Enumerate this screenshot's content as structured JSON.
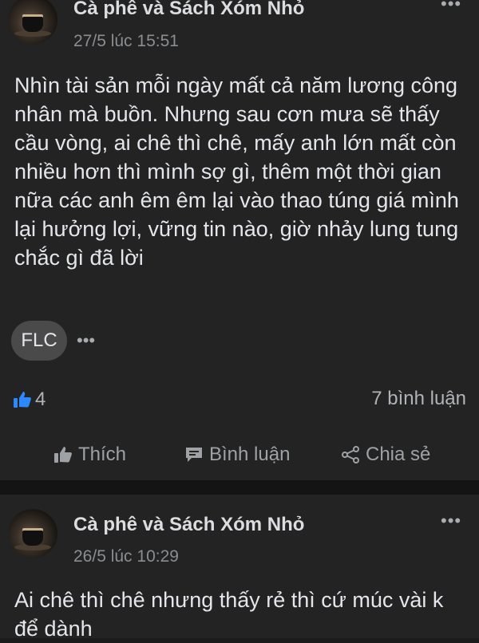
{
  "posts": [
    {
      "author": "Cà phê và Sách Xóm Nhỏ",
      "time": "27/5 lúc 15:51",
      "more": "•••",
      "body": "Nhìn tài sản mỗi ngày mất cả năm lương công nhân mà buồn. Nhưng sau cơn mưa sẽ thấy cầu vòng, ai chê thì chê, mấy anh lớn mất còn nhiều hơn thì mình sợ gì, thêm một thời gian nữa các anh êm êm lại vào thao túng giá mình lại hưởng lợi, vững tin nào, giờ nhảy lung tung chắc gì đã lời",
      "tag": "FLC",
      "tag_more": "•••",
      "like_count": "4",
      "comment_count": "7 bình luận",
      "actions": {
        "like": "Thích",
        "comment": "Bình luận",
        "share": "Chia sẻ"
      }
    },
    {
      "author": "Cà phê và Sách Xóm Nhỏ",
      "time": "26/5 lúc 10:29",
      "more": "•••",
      "body": "Ai chê thì chê nhưng thấy rẻ thì cứ múc vài k để dành"
    }
  ],
  "colors": {
    "background": "#232323",
    "separator": "#141414",
    "text": "#e4e6eb",
    "muted": "#8a8d91",
    "like_blue": "#2d88ff"
  },
  "icons": [
    "ellipsis-icon",
    "like-thumb-icon",
    "comment-icon",
    "share-icon"
  ]
}
